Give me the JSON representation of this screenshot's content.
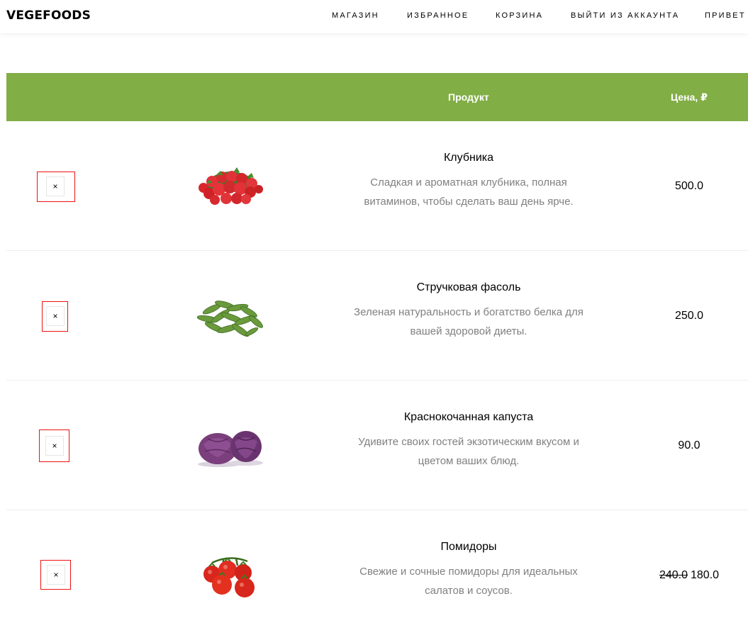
{
  "nav": {
    "brand": "VEGEFOODS",
    "items": [
      "МАГАЗИН",
      "ИЗБРАННОЕ",
      "КОРЗИНА",
      "ВЫЙТИ ИЗ АККАУНТА",
      "ПРИВЕТ"
    ]
  },
  "table": {
    "headers": {
      "product": "Продукт",
      "price": "Цена, ₽"
    },
    "remove_symbol": "×",
    "rows": [
      {
        "name": "Клубника",
        "description": "Сладкая и ароматная клубника, полная витаминов, чтобы сделать ваш день ярче.",
        "price": "500.0",
        "old_price": "",
        "image": "strawberries"
      },
      {
        "name": "Стручковая фасоль",
        "description": "Зеленая натуральность и богатство белка для вашей здоровой диеты.",
        "price": "250.0",
        "old_price": "",
        "image": "green-beans"
      },
      {
        "name": "Краснокочанная капуста",
        "description": "Удивите своих гостей экзотическим вкусом и цветом ваших блюд.",
        "price": "90.0",
        "old_price": "",
        "image": "red-cabbage"
      },
      {
        "name": "Помидоры",
        "description": "Свежие и сочные помидоры для идеальных салатов и соусов.",
        "price": "180.0",
        "old_price": "240.0",
        "image": "tomatoes"
      }
    ]
  },
  "colors": {
    "accent": "#82ae46",
    "remove_outline": "#e11111",
    "muted_text": "#808080"
  }
}
